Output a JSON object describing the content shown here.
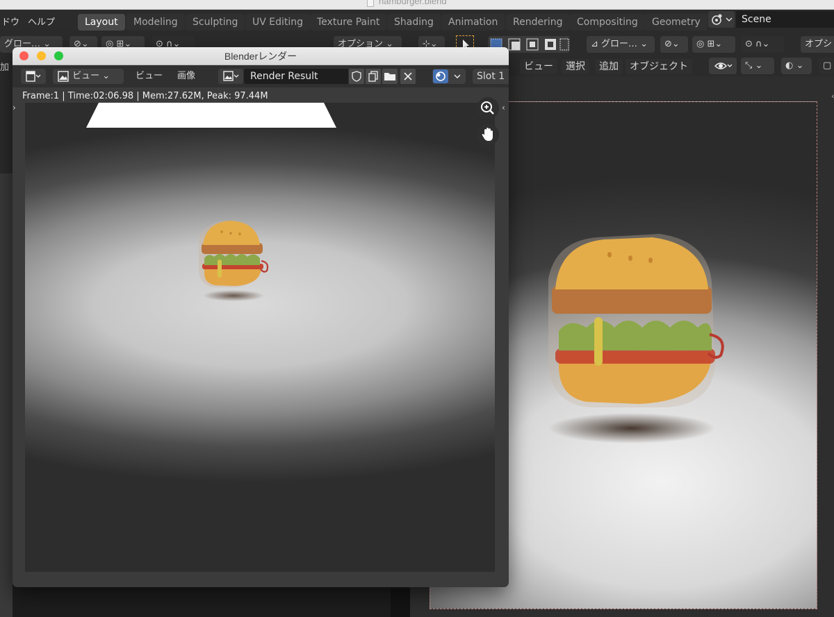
{
  "os_window": {
    "filename": "hamburger.blend"
  },
  "topbar": {
    "menu": [
      "ドウ",
      "ヘルプ"
    ],
    "workspace_tabs": [
      "Layout",
      "Modeling",
      "Sculpting",
      "UV Editing",
      "Texture Paint",
      "Shading",
      "Animation",
      "Rendering",
      "Compositing",
      "Geometry"
    ],
    "active_tab": "Layout",
    "scene_name": "Scene"
  },
  "toolbar2": {
    "left_transform": "グロー…",
    "options_left": "オプション",
    "right_transform": "グロー…",
    "options_right": "オプシ"
  },
  "viewport_header": {
    "menus": [
      "ビュー",
      "選択",
      "追加",
      "オブジェクト"
    ],
    "left_clip_text": "加"
  },
  "render_window": {
    "title": "Blenderレンダー",
    "view_dropdown": "ビュー",
    "menu_view": "ビュー",
    "menu_image": "画像",
    "image_name": "Render Result",
    "slot": "Slot 1",
    "status": "Frame:1 | Time:02:06.98 | Mem:27.62M, Peak: 97.44M"
  },
  "colors": {
    "accent_blue": "#4772b3",
    "traffic_close": "#ff5f57",
    "traffic_min": "#febc2e",
    "traffic_max": "#28c840",
    "selection_orange": "#e8a33d"
  }
}
